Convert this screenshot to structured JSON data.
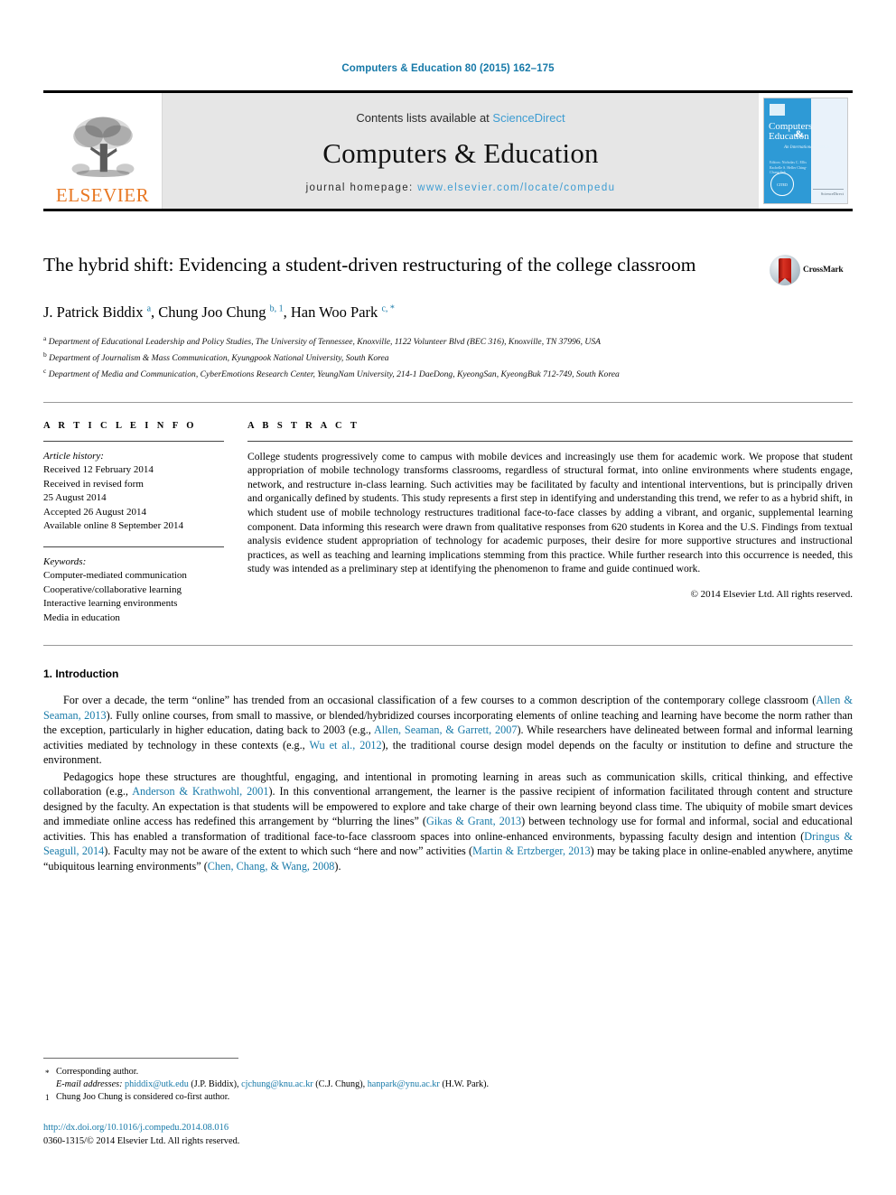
{
  "running_head": "Computers & Education 80 (2015) 162–175",
  "masthead": {
    "publisher_name": "ELSEVIER",
    "contents_prefix": "Contents lists available at ",
    "contents_link": "ScienceDirect",
    "journal_title": "Computers & Education",
    "homepage_prefix": "journal homepage: ",
    "homepage_url": "www.elsevier.com/locate/compedu",
    "cover": {
      "title_line1": "Computers",
      "title_amp": "&",
      "title_line2": "Education",
      "subtitle": "An International Journal",
      "editors": "Editors:\nNicholas C. Ellis\nRachelle S. Heller\nChing-Chung Yeh",
      "seal_text": "CITED",
      "sciencedirect_mark": "ScienceDirect"
    }
  },
  "article": {
    "title": "The hybrid shift: Evidencing a student-driven restructuring of the college classroom",
    "crossmark_label": "CrossMark",
    "authors_html": "J. Patrick Biddix <sup>a</sup>, Chung Joo Chung <sup>b, 1</sup>, Han Woo Park <sup>c, *</sup>",
    "affiliations": [
      "<sup>a</sup> Department of Educational Leadership and Policy Studies, The University of Tennessee, Knoxville, 1122 Volunteer Blvd (BEC 316), Knoxville, TN 37996, USA",
      "<sup>b</sup> Department of Journalism & Mass Communication, Kyungpook National University, South Korea",
      "<sup>c</sup> Department of Media and Communication, CyberEmotions Research Center, YeungNam University, 214-1 DaeDong, KyeongSan, KyeongBuk 712-749, South Korea"
    ]
  },
  "article_info": {
    "label": "A R T I C L E   I N F O",
    "history_heading": "Article history:",
    "history": [
      "Received 12 February 2014",
      "Received in revised form",
      "25 August 2014",
      "Accepted 26 August 2014",
      "Available online 8 September 2014"
    ],
    "keywords_heading": "Keywords:",
    "keywords": [
      "Computer-mediated communication",
      "Cooperative/collaborative learning",
      "Interactive learning environments",
      "Media in education"
    ]
  },
  "abstract": {
    "label": "A B S T R A C T",
    "text": "College students progressively come to campus with mobile devices and increasingly use them for academic work. We propose that student appropriation of mobile technology transforms classrooms, regardless of structural format, into online environments where students engage, network, and restructure in-class learning. Such activities may be facilitated by faculty and intentional interventions, but is principally driven and organically defined by students. This study represents a first step in identifying and understanding this trend, we refer to as a hybrid shift, in which student use of mobile technology restructures traditional face-to-face classes by adding a vibrant, and organic, supplemental learning component. Data informing this research were drawn from qualitative responses from 620 students in Korea and the U.S. Findings from textual analysis evidence student appropriation of technology for academic purposes, their desire for more supportive structures and instructional practices, as well as teaching and learning implications stemming from this practice. While further research into this occurrence is needed, this study was intended as a preliminary step at identifying the phenomenon to frame and guide continued work.",
    "copyright": "© 2014 Elsevier Ltd. All rights reserved."
  },
  "introduction": {
    "heading": "1. Introduction",
    "paragraphs": [
      "For over a decade, the term “online” has trended from an occasional classification of a few courses to a common description of the contemporary college classroom (<span class=\"cite\">Allen &amp; Seaman, 2013</span>). Fully online courses, from small to massive, or blended/hybridized courses incorporating elements of online teaching and learning have become the norm rather than the exception, particularly in higher education, dating back to 2003 (e.g., <span class=\"cite\">Allen, Seaman, &amp; Garrett, 2007</span>). While researchers have delineated between formal and informal learning activities mediated by technology in these contexts (e.g., <span class=\"cite\">Wu et al., 2012</span>), the traditional course design model depends on the faculty or institution to define and structure the environment.",
      "Pedagogics hope these structures are thoughtful, engaging, and intentional in promoting learning in areas such as communication skills, critical thinking, and effective collaboration (e.g., <span class=\"cite\">Anderson &amp; Krathwohl, 2001</span>). In this conventional arrangement, the learner is the passive recipient of information facilitated through content and structure designed by the faculty. An expectation is that students will be empowered to explore and take charge of their own learning beyond class time. The ubiquity of mobile smart devices and immediate online access has redefined this arrangement by “blurring the lines” (<span class=\"cite\">Gikas &amp; Grant, 2013</span>) between technology use for formal and informal, social and educational activities. This has enabled a transformation of traditional face-to-face classroom spaces into online-enhanced environments, bypassing faculty design and intention (<span class=\"cite\">Dringus &amp; Seagull, 2014</span>). Faculty may not be aware of the extent to which such “here and now” activities (<span class=\"cite\">Martin &amp; Ertzberger, 2013</span>) may be taking place in online-enabled anywhere, anytime “ubiquitous learning environments” (<span class=\"cite\">Chen, Chang, &amp; Wang, 2008</span>)."
    ]
  },
  "footnotes": {
    "corresponding": "Corresponding author.",
    "emails_html": "<em>E-mail addresses:</em> <span class=\"cite\">phiddix@utk.edu</span> (J.P. Biddix), <span class=\"cite\">cjchung@knu.ac.kr</span> (C.J. Chung), <span class=\"cite\">hanpark@ynu.ac.kr</span> (H.W. Park).",
    "cofirst": "Chung Joo Chung is considered co-first author."
  },
  "doi": {
    "url": "http://dx.doi.org/10.1016/j.compedu.2014.08.016",
    "issn_line": "0360-1315/© 2014 Elsevier Ltd. All rights reserved."
  }
}
